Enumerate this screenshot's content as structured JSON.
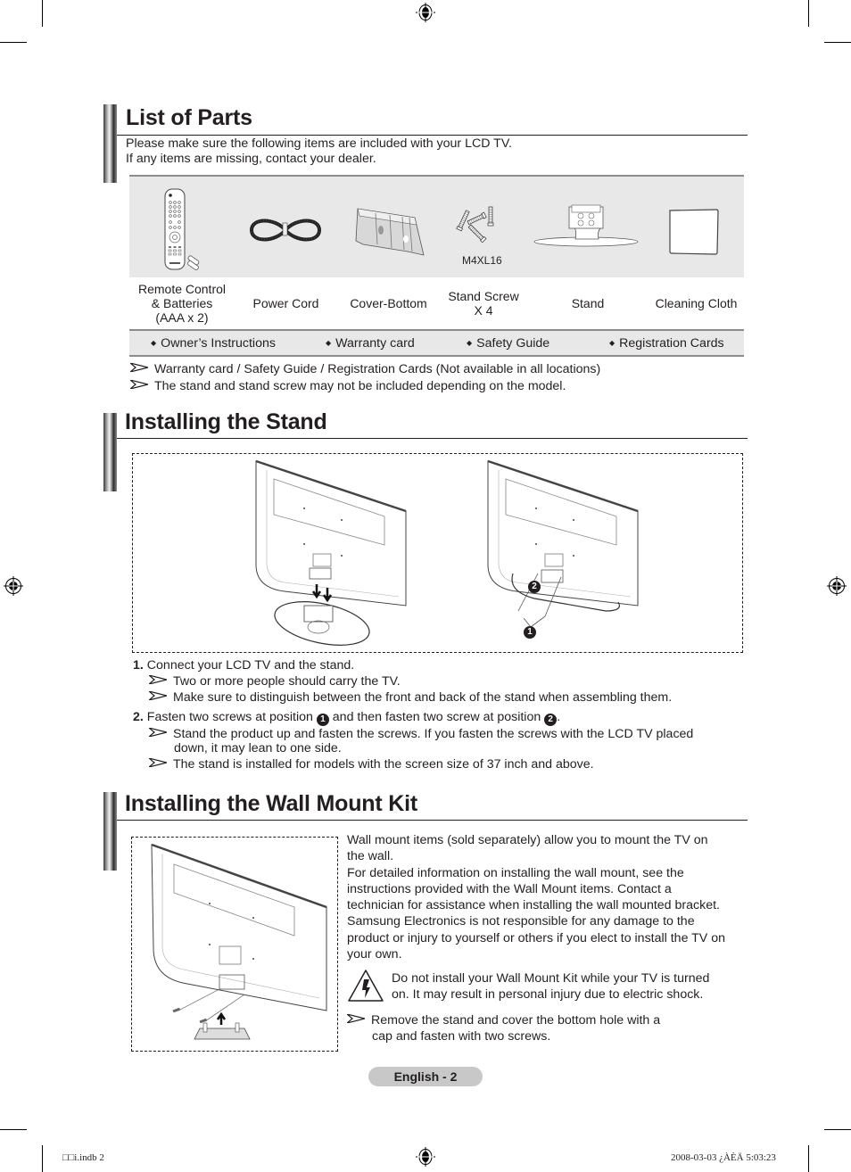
{
  "list_of_parts": {
    "title": "List of Parts",
    "intro_line1": "Please make sure the following items are included with your LCD TV.",
    "intro_line2": "If any items are missing, contact your dealer.",
    "parts": [
      {
        "icon": "remote-control-icon",
        "image_label": "",
        "label_lines": [
          "Remote Control",
          "& Batteries",
          "(AAA x 2)"
        ]
      },
      {
        "icon": "power-cord-icon",
        "image_label": "",
        "label_lines": [
          "Power Cord"
        ]
      },
      {
        "icon": "cover-bottom-icon",
        "image_label": "",
        "label_lines": [
          "Cover-Bottom"
        ]
      },
      {
        "icon": "stand-screw-icon",
        "image_label": "M4XL16",
        "label_lines": [
          "Stand Screw",
          "X 4"
        ]
      },
      {
        "icon": "stand-icon",
        "image_label": "",
        "label_lines": [
          "Stand"
        ]
      },
      {
        "icon": "cleaning-cloth-icon",
        "image_label": "",
        "label_lines": [
          "Cleaning Cloth"
        ]
      }
    ],
    "extras": [
      "Owner’s Instructions",
      "Warranty card",
      "Safety Guide",
      "Registration Cards"
    ],
    "notes": [
      "Warranty card / Safety Guide / Registration Cards (Not available in all locations)",
      "The stand and stand screw may not be included depending on the model."
    ]
  },
  "installing_stand": {
    "title": "Installing the Stand",
    "callouts": [
      "1",
      "2"
    ],
    "steps": [
      {
        "number": "1.",
        "text": "Connect your LCD TV and the stand.",
        "notes": [
          "Two or more people should carry the TV.",
          "Make sure to distinguish between the front and back of the stand when assembling them."
        ]
      },
      {
        "number": "2.",
        "text_before": "Fasten two screws at position",
        "pos1": "1",
        "text_middle": "and then fasten two screw at position",
        "pos2": "2",
        "text_after": ".",
        "notes": [
          "Stand the product up and fasten the screws. If you fasten the screws with the LCD TV placed",
          "down, it may lean to one side.",
          "The stand is installed for models with the screen size of 37 inch and above."
        ]
      }
    ]
  },
  "wall_mount": {
    "title": "Installing the Wall Mount Kit",
    "paragraph_lines": [
      "Wall mount items (sold separately) allow you to mount the TV on",
      "the wall.",
      "For detailed information on installing the wall mount, see the",
      "instructions provided with the Wall Mount items. Contact a",
      "technician for assistance when installing the wall mounted bracket.",
      "Samsung Electronics is not responsible for any damage to the",
      "product or injury to yourself or others if you elect to install the TV on",
      "your own."
    ],
    "warning_lines": [
      "Do not install your Wall Mount Kit while your TV is turned",
      "on. It may result in personal injury due to electric shock."
    ],
    "note_lines": [
      "Remove the stand and cover the bottom hole with a",
      "cap and fasten with two screws."
    ]
  },
  "footer": {
    "page_label": "English - 2",
    "slug_left": "□□i.indb   2",
    "slug_right": "2008-03-03   ¿ÀÈÄ 5:03:23"
  }
}
